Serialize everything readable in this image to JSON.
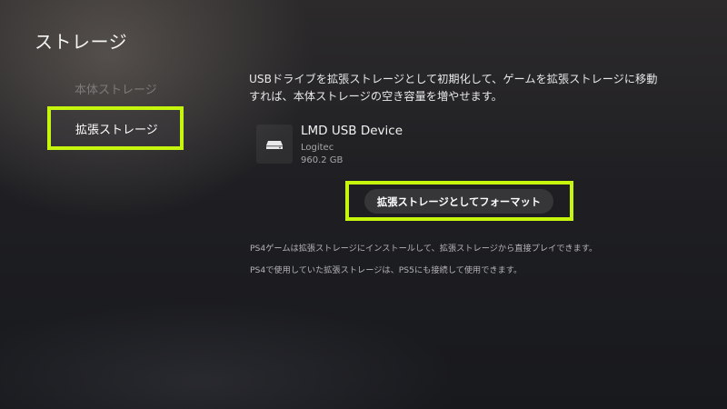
{
  "page": {
    "title": "ストレージ"
  },
  "sidebar": {
    "items": [
      {
        "label": "本体ストレージ",
        "selected": false
      },
      {
        "label": "拡張ストレージ",
        "selected": true
      }
    ]
  },
  "main": {
    "description": "USBドライブを拡張ストレージとして初期化して、ゲームを拡張ストレージに移動すれば、本体ストレージの空き容量を増やせます。",
    "device": {
      "icon": "usb-drive-icon",
      "name": "LMD USB Device",
      "vendor": "Logitec",
      "size": "960.2 GB"
    },
    "format_button_label": "拡張ストレージとしてフォーマット",
    "notes": [
      "PS4ゲームは拡張ストレージにインストールして、拡張ストレージから直接プレイできます。",
      "PS4で使用していた拡張ストレージは、PS5にも接続して使用できます。"
    ]
  },
  "colors": {
    "highlight": "#c6f60e",
    "button_bg": "#363538"
  }
}
